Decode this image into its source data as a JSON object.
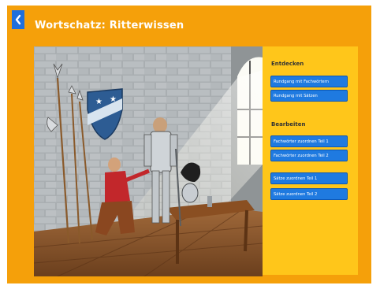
{
  "header": {
    "title": "Wortschatz: Ritterwissen",
    "back_icon": "chevron-left-icon"
  },
  "panel": {
    "sections": [
      {
        "heading": "Entdecken",
        "buttons": [
          "Rundgang mit Fachwörtern",
          "Rundgang mit Sätzen"
        ]
      },
      {
        "heading": "Bearbeiten",
        "buttons": [
          "Fachwörter zuordnen Teil 1",
          "Fachwörter zuordnen Teil 2",
          "Sätze zuordnen Teil 1",
          "Sätze zuordnen Teil 2"
        ]
      }
    ]
  },
  "colors": {
    "accent": "#f5a00a",
    "panel": "#ffc61a",
    "button": "#1f7ae0",
    "button_border": "#0c57b5"
  }
}
